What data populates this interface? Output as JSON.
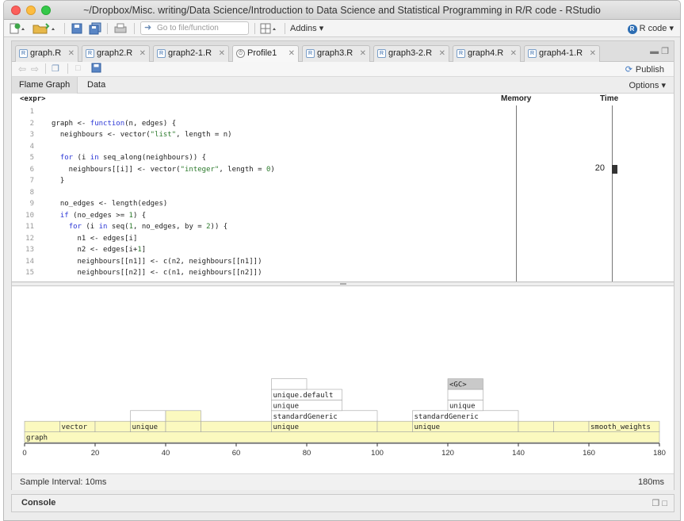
{
  "window": {
    "title": "~/Dropbox/Misc. writing/Data Science/Introduction to Data Science and Statistical Programming in R/R code - RStudio"
  },
  "toolbar": {
    "goto_placeholder": "Go to file/function",
    "addins_label": "Addins",
    "project_label": "R code"
  },
  "editor": {
    "tabs": [
      {
        "label": "graph.R",
        "active": false
      },
      {
        "label": "graph2.R",
        "active": false
      },
      {
        "label": "graph2-1.R",
        "active": false
      },
      {
        "label": "Profile1",
        "active": true
      },
      {
        "label": "graph3.R",
        "active": false
      },
      {
        "label": "graph3-2.R",
        "active": false
      },
      {
        "label": "graph4.R",
        "active": false
      },
      {
        "label": "graph4-1.R",
        "active": false
      }
    ],
    "publish_label": "Publish",
    "view_tabs": [
      {
        "label": "Flame Graph",
        "active": true
      },
      {
        "label": "Data",
        "active": false
      }
    ],
    "options_label": "Options"
  },
  "profile_table": {
    "headers": {
      "expr": "<expr>",
      "memory": "Memory",
      "time": "Time"
    },
    "code_lines": [
      {
        "n": "1",
        "code": ""
      },
      {
        "n": "2",
        "code": "graph <- function(n, edges) {"
      },
      {
        "n": "3",
        "code": "  neighbours <- vector(\"list\", length = n)"
      },
      {
        "n": "4",
        "code": ""
      },
      {
        "n": "5",
        "code": "  for (i in seq_along(neighbours)) {"
      },
      {
        "n": "6",
        "code": "    neighbours[[i]] <- vector(\"integer\", length = 0)"
      },
      {
        "n": "7",
        "code": "  }"
      },
      {
        "n": "8",
        "code": ""
      },
      {
        "n": "9",
        "code": "  no_edges <- length(edges)"
      },
      {
        "n": "10",
        "code": "  if (no_edges >= 1) {"
      },
      {
        "n": "11",
        "code": "    for (i in seq(1, no_edges, by = 2)) {"
      },
      {
        "n": "12",
        "code": "      n1 <- edges[i]"
      },
      {
        "n": "13",
        "code": "      n2 <- edges[i+1]"
      },
      {
        "n": "14",
        "code": "      neighbours[[n1]] <- c(n2, neighbours[[n1]])"
      },
      {
        "n": "15",
        "code": "      neighbours[[n2]] <- c(n1, neighbours[[n2]])"
      }
    ],
    "time_value": "20",
    "time_line": "6"
  },
  "chart_data": {
    "type": "flame",
    "x_ticks": [
      0,
      20,
      40,
      60,
      80,
      100,
      120,
      140,
      160,
      180
    ],
    "xlim": [
      0,
      180
    ],
    "frames": [
      {
        "label": "graph",
        "start": 0,
        "end": 180,
        "level": 0,
        "color": "#fbf9bf"
      },
      {
        "label": "",
        "start": 0,
        "end": 10,
        "level": 1,
        "color": "#fbf9bf"
      },
      {
        "label": "vector",
        "start": 10,
        "end": 20,
        "level": 1,
        "color": "#fbf9bf"
      },
      {
        "label": "",
        "start": 20,
        "end": 30,
        "level": 1,
        "color": "#fbf9bf"
      },
      {
        "label": "unique",
        "start": 30,
        "end": 40,
        "level": 1,
        "color": "#fbf9bf"
      },
      {
        "label": "",
        "start": 40,
        "end": 50,
        "level": 1,
        "color": "#fbf9bf"
      },
      {
        "label": "",
        "start": 50,
        "end": 70,
        "level": 1,
        "color": "#fbf9bf"
      },
      {
        "label": "unique",
        "start": 70,
        "end": 100,
        "level": 1,
        "color": "#fbf9bf"
      },
      {
        "label": "",
        "start": 100,
        "end": 110,
        "level": 1,
        "color": "#fbf9bf"
      },
      {
        "label": "unique",
        "start": 110,
        "end": 140,
        "level": 1,
        "color": "#fbf9bf"
      },
      {
        "label": "",
        "start": 140,
        "end": 150,
        "level": 1,
        "color": "#fbf9bf"
      },
      {
        "label": "",
        "start": 150,
        "end": 160,
        "level": 1,
        "color": "#fbf9bf"
      },
      {
        "label": "smooth_weights",
        "start": 160,
        "end": 180,
        "level": 1,
        "color": "#fbf9bf"
      },
      {
        "label": "",
        "start": 30,
        "end": 40,
        "level": 2,
        "color": "#ffffff"
      },
      {
        "label": "",
        "start": 40,
        "end": 50,
        "level": 2,
        "color": "#fbf9bf"
      },
      {
        "label": "standardGeneric",
        "start": 70,
        "end": 100,
        "level": 2,
        "color": "#ffffff"
      },
      {
        "label": "standardGeneric",
        "start": 110,
        "end": 140,
        "level": 2,
        "color": "#ffffff"
      },
      {
        "label": "unique",
        "start": 70,
        "end": 90,
        "level": 3,
        "color": "#ffffff"
      },
      {
        "label": "unique",
        "start": 120,
        "end": 130,
        "level": 3,
        "color": "#ffffff"
      },
      {
        "label": "unique.default",
        "start": 70,
        "end": 90,
        "level": 4,
        "color": "#ffffff"
      },
      {
        "label": "",
        "start": 120,
        "end": 130,
        "level": 4,
        "color": "#ffffff"
      },
      {
        "label": "",
        "start": 70,
        "end": 80,
        "level": 5,
        "color": "#ffffff"
      },
      {
        "label": "<GC>",
        "start": 120,
        "end": 130,
        "level": 5,
        "color": "#c9c9c9"
      }
    ]
  },
  "statusbar": {
    "sample_interval": "Sample Interval: 10ms",
    "total_time": "180ms"
  },
  "console": {
    "title": "Console"
  }
}
